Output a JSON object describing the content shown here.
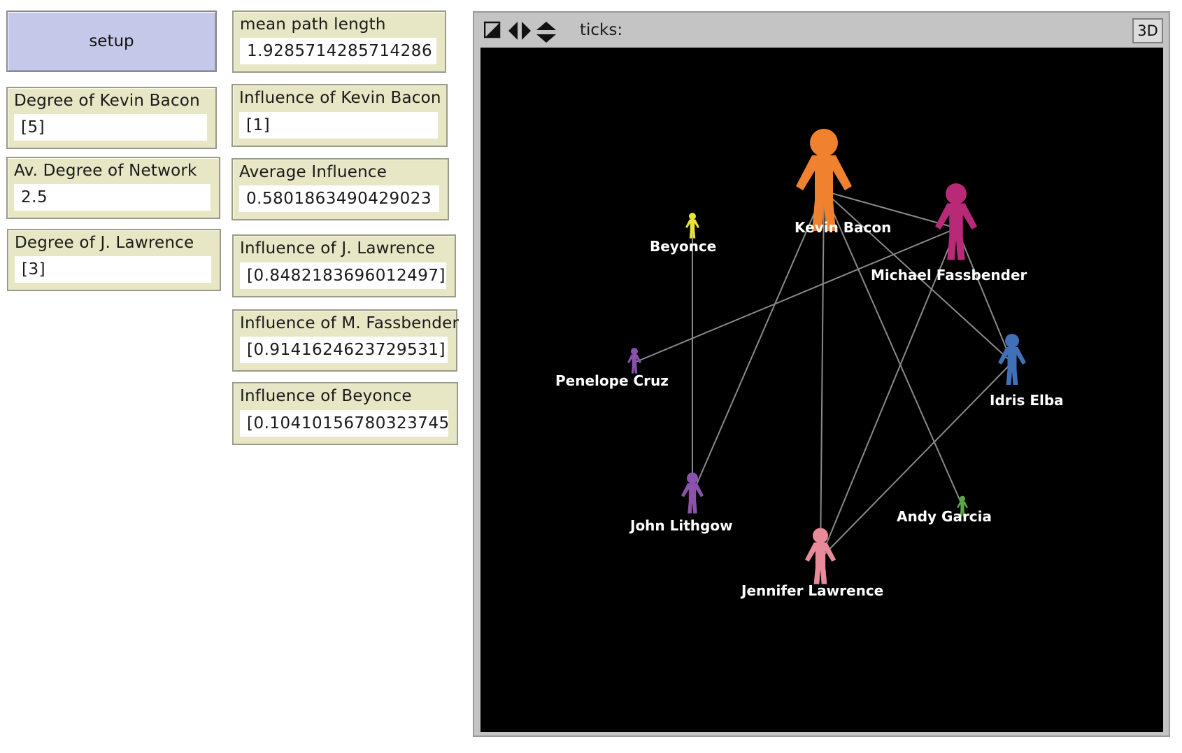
{
  "controls": {
    "setup_label": "setup"
  },
  "monitors": {
    "degree_kevin_bacon": {
      "label": "Degree of Kevin Bacon",
      "value": "[5]"
    },
    "av_degree_network": {
      "label": "Av. Degree of Network",
      "value": "2.5"
    },
    "degree_j_lawrence": {
      "label": "Degree of  J. Lawrence",
      "value": "[3]"
    },
    "mean_path_length": {
      "label": "mean path length",
      "value": "1.9285714285714286"
    },
    "influence_kevin_bacon": {
      "label": "Influence of Kevin Bacon",
      "value": "[1]"
    },
    "average_influence": {
      "label": "Average Influence",
      "value": "0.5801863490429023"
    },
    "influence_j_lawrence": {
      "label": "Influence of J. Lawrence",
      "value": "[0.8482183696012497]"
    },
    "influence_m_fassbender": {
      "label": "Influence of M. Fassbender",
      "value": "[0.9141624623729531]"
    },
    "influence_beyonce": {
      "label": "Influence of Beyonce",
      "value": "[0.10410156780323745]"
    }
  },
  "view": {
    "ticks_label": "ticks:",
    "three_d_label": "3D",
    "icons": [
      "view-fullscreen-icon",
      "horizontal-arrows-icon",
      "vertical-arrows-icon"
    ],
    "nodes": [
      {
        "id": "kb",
        "name": "Kevin Bacon",
        "color": "#f0812f"
      },
      {
        "id": "mf",
        "name": "Michael Fassbender",
        "color": "#b82a77"
      },
      {
        "id": "be",
        "name": "Beyonce",
        "color": "#e9e33c"
      },
      {
        "id": "pc",
        "name": "Penelope Cruz",
        "color": "#8a52ad"
      },
      {
        "id": "ie",
        "name": "Idris Elba",
        "color": "#4070b8"
      },
      {
        "id": "jl",
        "name": "John Lithgow",
        "color": "#8a52ad"
      },
      {
        "id": "ag",
        "name": "Andy Garcia",
        "color": "#5aa84a"
      },
      {
        "id": "jw",
        "name": "Jennifer Lawrence",
        "color": "#e88a9a"
      }
    ],
    "links": [
      [
        "kb",
        "mf"
      ],
      [
        "kb",
        "ie"
      ],
      [
        "kb",
        "jl"
      ],
      [
        "kb",
        "jw"
      ],
      [
        "kb",
        "ag"
      ],
      [
        "mf",
        "pc"
      ],
      [
        "mf",
        "ie"
      ],
      [
        "mf",
        "jw"
      ],
      [
        "be",
        "jl"
      ],
      [
        "ie",
        "jw"
      ]
    ],
    "link_color": "#8a8a8a"
  }
}
